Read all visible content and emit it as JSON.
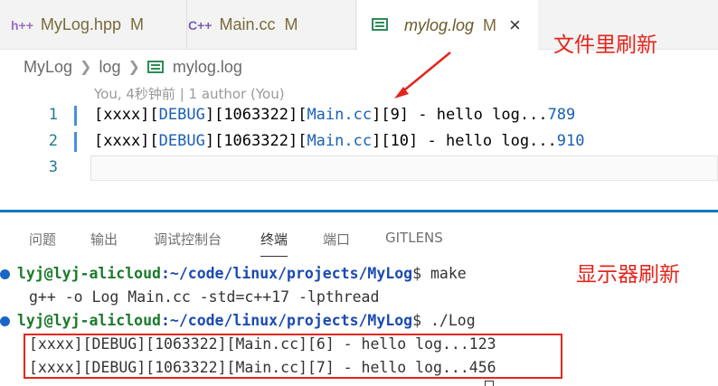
{
  "tabs": [
    {
      "icon": "h++",
      "label": "MyLog.hpp",
      "status": "M"
    },
    {
      "icon": "C++",
      "label": "Main.cc",
      "status": "M"
    },
    {
      "label": "mylog.log",
      "status": "M",
      "close": "×"
    }
  ],
  "annotations": {
    "file_refresh": "文件里刷新",
    "screen_refresh": "显示器刷新"
  },
  "breadcrumb": [
    "MyLog",
    "log",
    "mylog.log"
  ],
  "blame": "You, 4秒钟前 | 1 author (You)",
  "editor": {
    "lines": [
      {
        "num": "1",
        "p1": "[xxxx][",
        "p2": "DEBUG",
        "p3": "][1063322][",
        "p4": "Main.cc",
        "p5": "][9] - hello log...",
        "p6": "789"
      },
      {
        "num": "2",
        "p1": "[xxxx][",
        "p2": "DEBUG",
        "p3": "][1063322][",
        "p4": "Main.cc",
        "p5": "][10] - hello log...",
        "p6": "910"
      },
      {
        "num": "3"
      }
    ]
  },
  "panel_tabs": [
    "问题",
    "输出",
    "调试控制台",
    "终端",
    "端口",
    "GITLENS"
  ],
  "terminal": {
    "prompt_user": "lyj@lyj-alicloud",
    "prompt_path": ":~/code/linux/projects/MyLog",
    "cmd1": "$ make",
    "out1": "g++ -o Log Main.cc -std=c++17 -lpthread",
    "cmd2": "$ ./Log",
    "out2": "[xxxx][DEBUG][1063322][Main.cc][6] - hello log...123",
    "out3": "[xxxx][DEBUG][1063322][Main.cc][7] - hello log...456"
  }
}
